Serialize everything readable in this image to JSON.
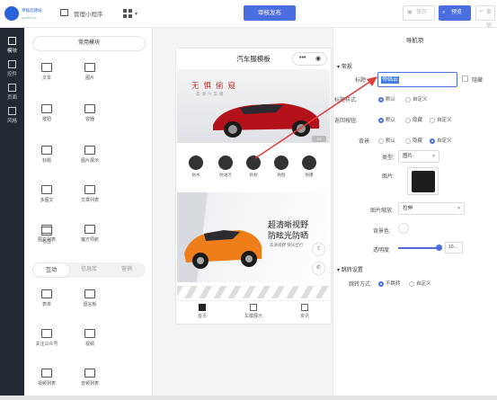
{
  "app": {
    "logo_title": "帝临云建站",
    "logo_sub": "qq393.cn",
    "manager_label": "管理小程序"
  },
  "toolbar": {
    "publish": "审核发布",
    "save": "保存",
    "preview": "预览",
    "undo": "撤销"
  },
  "sidebar": {
    "items": [
      {
        "label": "模块",
        "icon": "plus-box-icon"
      },
      {
        "label": "控件",
        "icon": "controls-icon"
      },
      {
        "label": "页面",
        "icon": "page-icon"
      },
      {
        "label": "风格",
        "icon": "palette-icon"
      }
    ]
  },
  "panel": {
    "section_title": "常用模块",
    "modules": [
      "文本",
      "图片",
      "按钮",
      "容器",
      "标题",
      "图片展示",
      "多图文",
      "文章列表",
      "图文列表",
      "魔方导航",
      "标签"
    ],
    "tabs": [
      "互动",
      "信息库",
      "营销"
    ],
    "interactive": [
      "表单",
      "留言板",
      "关注公众号",
      "视频",
      "视频列表",
      "音频列表"
    ]
  },
  "phone": {
    "title": "汽车服模板",
    "banner1_title": "无惧偷窥",
    "banner1_sub": "高清汽车膜",
    "pager": "1/2",
    "icons": [
      "防水",
      "防油污",
      "防划",
      "防刮",
      "防爆"
    ],
    "banner2_title1": "超清晰视野",
    "banner2_title2": "防眩光防晒",
    "banner2_sub": "高清视野 快乐出行",
    "tabs": [
      "首页",
      "车膜展示",
      "资讯"
    ]
  },
  "props": {
    "title": "导航项",
    "section_general": "常规",
    "title_label": "标题:",
    "title_value": "帝临云",
    "hide_label": "隐藏",
    "title_style_label": "标题样式:",
    "title_style_options": [
      "默认",
      "自定义"
    ],
    "title_style_selected": "默认",
    "back_label": "返回按钮:",
    "back_options": [
      "默认",
      "隐藏",
      "自定义"
    ],
    "back_selected": "默认",
    "bg_label": "背景:",
    "bg_options": [
      "默认",
      "隐藏",
      "自定义"
    ],
    "bg_selected": "自定义",
    "type_label": "类型:",
    "type_value": "图片",
    "image_label": "图片:",
    "image_scale_label": "图片缩放:",
    "image_scale_value": "拉伸",
    "bg_color_label": "背景色:",
    "opacity_label": "透明度:",
    "opacity_value": "10...",
    "opacity_level": 1.0,
    "section_jump": "跳转设置",
    "jump_label": "跳转方式:",
    "jump_options": [
      "不跳转",
      "自定义"
    ],
    "jump_selected": "不跳转"
  },
  "colors": {
    "accent": "#4a6ee0",
    "sidebar": "#222933",
    "arrow": "#e23b3b"
  }
}
